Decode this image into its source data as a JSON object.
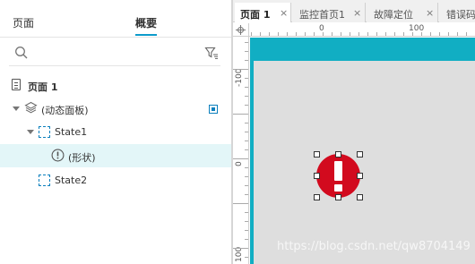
{
  "left_panel": {
    "tabs": {
      "pages": "页面",
      "outline": "概要"
    },
    "search": {
      "placeholder": "",
      "value": ""
    },
    "tree": {
      "page": {
        "label": "页面 1"
      },
      "dynamic_panel": {
        "label": "(动态面板)",
        "expanded": true
      },
      "state1": {
        "label": "State1",
        "expanded": true
      },
      "shape": {
        "label": "(形状)",
        "selected": true
      },
      "state2": {
        "label": "State2"
      }
    }
  },
  "right_panel": {
    "tabs": [
      {
        "label": "页面 1",
        "close": "×",
        "active": true
      },
      {
        "label": "监控首页1",
        "close": "×",
        "active": false
      },
      {
        "label": "故障定位",
        "close": "×",
        "active": false
      },
      {
        "label": "错误码",
        "close": "",
        "active": false
      }
    ],
    "ruler_h_labels": [
      "0",
      "100"
    ],
    "ruler_v_labels": [
      "-100",
      "0",
      "100"
    ],
    "canvas": {
      "accent_color": "#11aec3",
      "widget": {
        "icon": "exclamation-circle-icon",
        "color": "#d20a1e"
      },
      "watermark": "https://blog.csdn.net/qw8704149"
    }
  }
}
